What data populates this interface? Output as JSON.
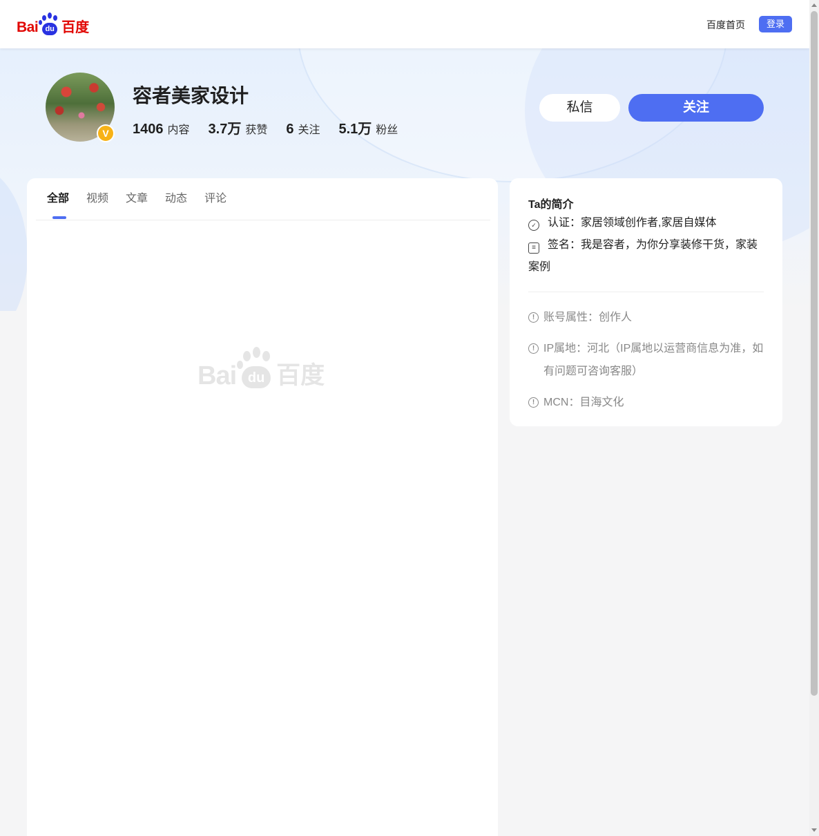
{
  "header": {
    "logo": {
      "latin": "Bai",
      "paw": "du",
      "chinese": "百度"
    },
    "home_link": "百度首页",
    "login_label": "登录"
  },
  "profile": {
    "name": "容者美家设计",
    "verified_badge": "V",
    "stats": [
      {
        "value": "1406",
        "label": "内容"
      },
      {
        "value": "3.7万",
        "label": "获赞"
      },
      {
        "value": "6",
        "label": "关注"
      },
      {
        "value": "5.1万",
        "label": "粉丝"
      }
    ],
    "message_label": "私信",
    "follow_label": "关注"
  },
  "tabs": [
    {
      "label": "全部",
      "active": true
    },
    {
      "label": "视频",
      "active": false
    },
    {
      "label": "文章",
      "active": false
    },
    {
      "label": "动态",
      "active": false
    },
    {
      "label": "评论",
      "active": false
    }
  ],
  "watermark": {
    "latin": "Bai",
    "paw": "du",
    "chinese": "百度"
  },
  "intro": {
    "title": "Ta的简介",
    "certification": "认证：家居领域创作者,家居自媒体",
    "signature": "签名：我是容者，为你分享装修干货，家装案例",
    "attributes": [
      {
        "text": "账号属性：创作人"
      },
      {
        "text": "IP属地：河北（IP属地以运营商信息为准，如有问题可咨询客服）"
      },
      {
        "text": "MCN：目海文化"
      }
    ]
  },
  "colors": {
    "accent": "#4e6ef2",
    "logo_red": "#e10602",
    "logo_blue": "#2932e1",
    "badge": "#f7b217"
  },
  "icons": {
    "certification": "check-circle-icon",
    "signature": "note-icon",
    "attribute": "info-circle-icon"
  }
}
